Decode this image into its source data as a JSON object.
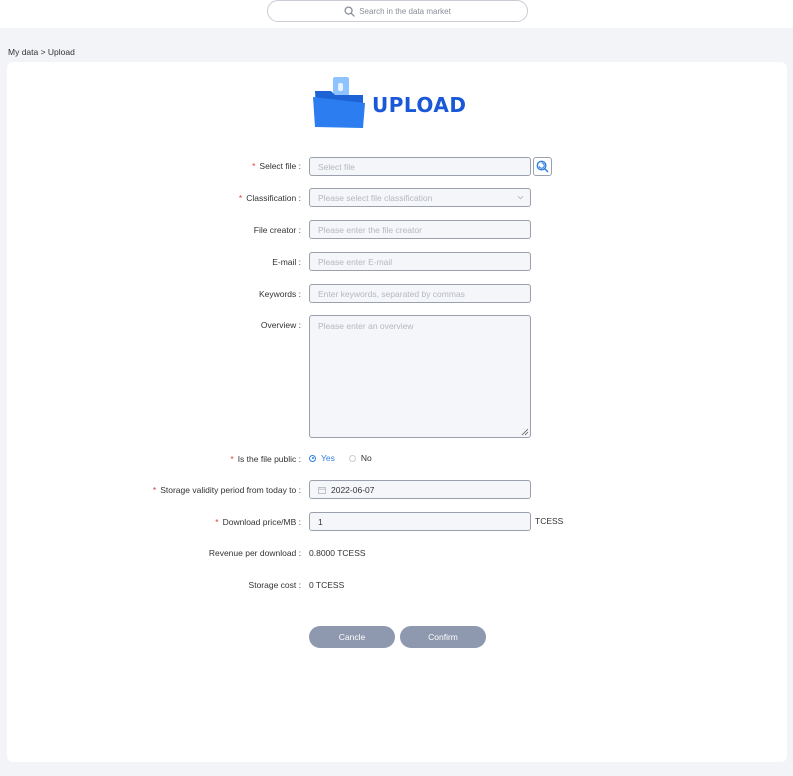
{
  "search": {
    "placeholder": "Search in the data market"
  },
  "breadcrumb": "My data > Upload",
  "header": {
    "title": "UPLOAD"
  },
  "form": {
    "select_file": {
      "label": "Select file :",
      "placeholder": "Select file",
      "required": true
    },
    "classification": {
      "label": "Classification :",
      "placeholder": "Please select file classification",
      "required": true
    },
    "file_creator": {
      "label": "File creator :",
      "placeholder": "Please enter the file creator"
    },
    "email": {
      "label": "E-mail :",
      "placeholder": "Please enter E-mail"
    },
    "keywords": {
      "label": "Keywords :",
      "placeholder": "Enter keywords, separated by commas"
    },
    "overview": {
      "label": "Overview :",
      "placeholder": "Please enter an overview"
    },
    "is_public": {
      "label": "Is the file public :",
      "required": true,
      "options": [
        "Yes",
        "No"
      ],
      "selected": "Yes"
    },
    "storage_validity": {
      "label": "Storage validity period from today to  :",
      "value": "2022-06-07",
      "required": true
    },
    "download_price": {
      "label": "Download price/MB  :",
      "value": "1",
      "unit": "TCESS",
      "required": true
    },
    "revenue_per_download": {
      "label": "Revenue per download :",
      "value": "0.8000 TCESS"
    },
    "storage_cost": {
      "label": "Storage cost :",
      "value": "0 TCESS"
    }
  },
  "buttons": {
    "cancel": "Cancle",
    "confirm": "Confirm"
  },
  "colors": {
    "accent": "#1a58d8",
    "required": "#e03c3c",
    "button": "#8e98ae",
    "radio_on": "#2f7fe0"
  }
}
